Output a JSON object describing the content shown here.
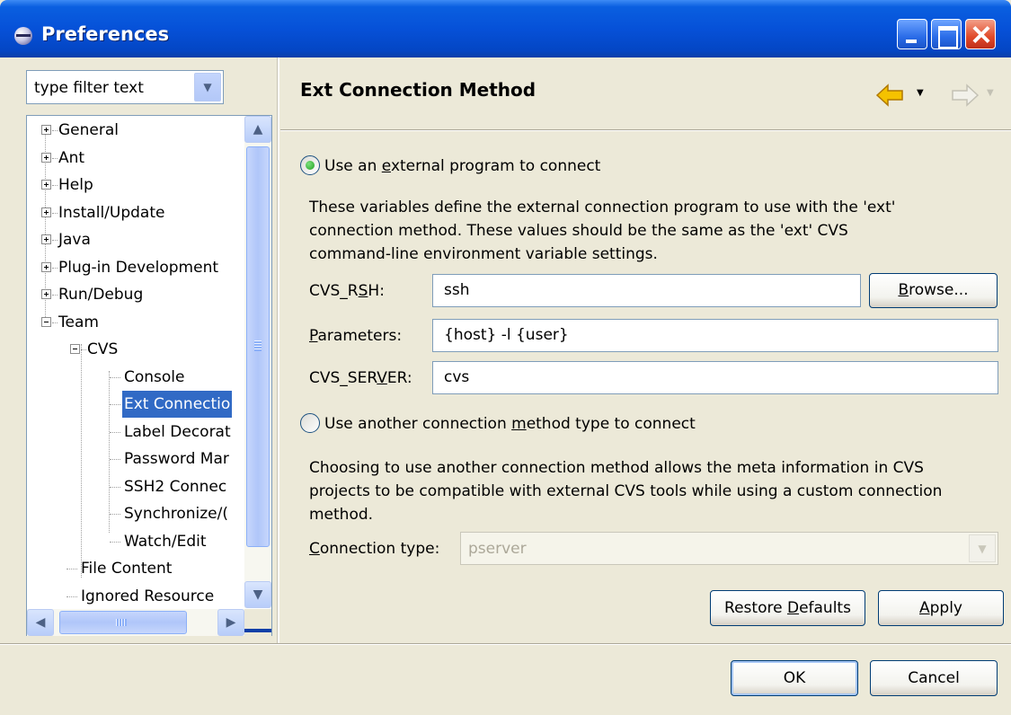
{
  "window": {
    "title": "Preferences",
    "icons": {
      "app": "eclipse-icon",
      "minimize": "minimize-icon",
      "maximize": "maximize-icon",
      "close": "close-icon"
    }
  },
  "nav": {
    "filter_text": "type filter text",
    "tree": [
      {
        "label": "General",
        "state": "collapsed",
        "depth": 0
      },
      {
        "label": "Ant",
        "state": "collapsed",
        "depth": 0
      },
      {
        "label": "Help",
        "state": "collapsed",
        "depth": 0
      },
      {
        "label": "Install/Update",
        "state": "collapsed",
        "depth": 0
      },
      {
        "label": "Java",
        "state": "collapsed",
        "depth": 0
      },
      {
        "label": "Plug-in Development",
        "state": "collapsed",
        "depth": 0
      },
      {
        "label": "Run/Debug",
        "state": "collapsed",
        "depth": 0
      },
      {
        "label": "Team",
        "state": "expanded",
        "depth": 0
      },
      {
        "label": "CVS",
        "state": "expanded",
        "depth": 1
      },
      {
        "label": "Console",
        "state": "leaf",
        "depth": 2
      },
      {
        "label": "Ext Connectio",
        "state": "leaf",
        "depth": 2,
        "selected": true
      },
      {
        "label": "Label Decorat",
        "state": "leaf",
        "depth": 2
      },
      {
        "label": "Password Mar",
        "state": "leaf",
        "depth": 2
      },
      {
        "label": "SSH2 Connec",
        "state": "leaf",
        "depth": 2
      },
      {
        "label": "Synchronize/(",
        "state": "leaf",
        "depth": 2
      },
      {
        "label": "Watch/Edit",
        "state": "leaf",
        "depth": 2
      },
      {
        "label": "File Content",
        "state": "leaf",
        "depth": 1
      },
      {
        "label": "Ignored Resource",
        "state": "leaf",
        "depth": 1
      }
    ]
  },
  "page": {
    "title": "Ext Connection Method",
    "nav_icons": {
      "back": "back-arrow-icon",
      "forward": "forward-arrow-icon",
      "dropdown": "chevron-down-icon"
    },
    "option_external": {
      "label_pre": "Use an ",
      "label_mnemonic": "e",
      "label_post": "xternal program to connect",
      "selected": true,
      "description_lines": [
        "These variables define the external connection program to use with the 'ext'",
        "connection method. These values should be the same as the 'ext' CVS",
        "command-line environment variable settings."
      ]
    },
    "fields": {
      "cvs_rsh": {
        "label_pre": "CVS_R",
        "label_mnemonic": "S",
        "label_post": "H:",
        "value": "ssh"
      },
      "parameters": {
        "label_pre": "",
        "label_mnemonic": "P",
        "label_post": "arameters:",
        "value": "{host} -l {user}"
      },
      "cvs_server": {
        "label_pre": "CVS_SER",
        "label_mnemonic": "V",
        "label_post": "ER:",
        "value": "cvs"
      }
    },
    "browse_button": {
      "pre": "",
      "mnemonic": "B",
      "post": "rowse..."
    },
    "option_other": {
      "label_pre": "Use another connection ",
      "label_mnemonic": "m",
      "label_post": "ethod type to connect",
      "selected": false,
      "description_lines": [
        "Choosing to use another connection method allows the meta information in CVS",
        "projects to be compatible with external CVS tools while using a custom connection",
        "method."
      ]
    },
    "connection_type": {
      "label_pre": "",
      "label_mnemonic": "C",
      "label_post": "onnection type:",
      "value": "pserver",
      "enabled": false
    },
    "restore_defaults": {
      "pre": "Restore ",
      "mnemonic": "D",
      "post": "efaults"
    },
    "apply": {
      "pre": "",
      "mnemonic": "A",
      "post": "pply"
    }
  },
  "dialog_buttons": {
    "ok": "OK",
    "cancel": "Cancel"
  },
  "colors": {
    "selection": "#316ac5",
    "titlebar": "#0651d8",
    "dialog_bg": "#ece9d8",
    "back_arrow": "#f0b000"
  }
}
